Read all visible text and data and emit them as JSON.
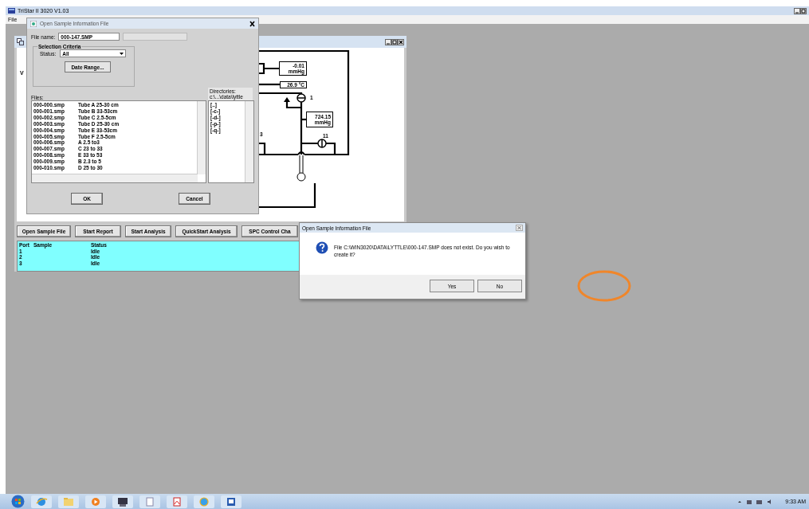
{
  "app_window": {
    "title": "TriStar II 3020 V1.03",
    "menu": [
      "File"
    ]
  },
  "sample_window": {
    "side_text": "V",
    "schematic": {
      "readouts": [
        {
          "value": "-0.01",
          "unit": "mmHg"
        },
        {
          "value": "26.9 °C"
        },
        {
          "value": "724.15",
          "unit": "mmHg"
        }
      ],
      "valve_labels": [
        "1",
        "11",
        "3"
      ]
    },
    "buttons": [
      "Open Sample File",
      "Start Report",
      "Start Analysis",
      "QuickStart Analysis",
      "SPC Control Cha"
    ],
    "status_table": {
      "columns": [
        "Port",
        "Sample",
        "Status"
      ],
      "rows": [
        {
          "port": "1",
          "status": "Idle"
        },
        {
          "port": "2",
          "status": "Idle"
        },
        {
          "port": "3",
          "status": "Idle"
        }
      ]
    }
  },
  "open_dialog": {
    "title": "Open Sample Information File",
    "file_name_label": "File name:",
    "file_name": "000-147.SMP",
    "selection_criteria": {
      "title": "Selection Criteria",
      "status_label": "Status:",
      "status": "All",
      "date_range_button": "Date Range..."
    },
    "files_label": "Files:",
    "files": [
      {
        "name": "000-000.smp",
        "description": "Tube A 25-30 cm"
      },
      {
        "name": "000-001.smp",
        "description": "Tube B 33-53cm"
      },
      {
        "name": "000-002.smp",
        "description": "Tube C 2.5-5cm"
      },
      {
        "name": "000-003.smp",
        "description": "Tube D 25-30 cm"
      },
      {
        "name": "000-004.smp",
        "description": "Tube E 33-53cm"
      },
      {
        "name": "000-005.smp",
        "description": "Tube F 2.5-5cm"
      },
      {
        "name": "000-006.smp",
        "description": "A 2.5 to3"
      },
      {
        "name": "000-007.smp",
        "description": "C 23 to 33"
      },
      {
        "name": "000-008.smp",
        "description": "E 33 to 53"
      },
      {
        "name": "000-009.smp",
        "description": "B 2.3 to 5"
      },
      {
        "name": "000-010.smp",
        "description": "D 25 to 30"
      }
    ],
    "directories_label": "Directories:",
    "directory_path": "c:\\...\\data\\lyttle",
    "directories": [
      "[..]",
      "[-c-]",
      "[-d-]",
      "[-p-]",
      "[-q-]"
    ],
    "buttons": [
      "OK",
      "Cancel"
    ]
  },
  "message_box": {
    "title": "Open Sample Information File",
    "message": "File C:\\WIN3020\\DATA\\LYTTLE\\000-147.SMP does not exist.  Do you wish to create it?",
    "buttons": [
      "Yes",
      "No"
    ]
  },
  "taskbar": {
    "clock": "9:33 AM"
  }
}
